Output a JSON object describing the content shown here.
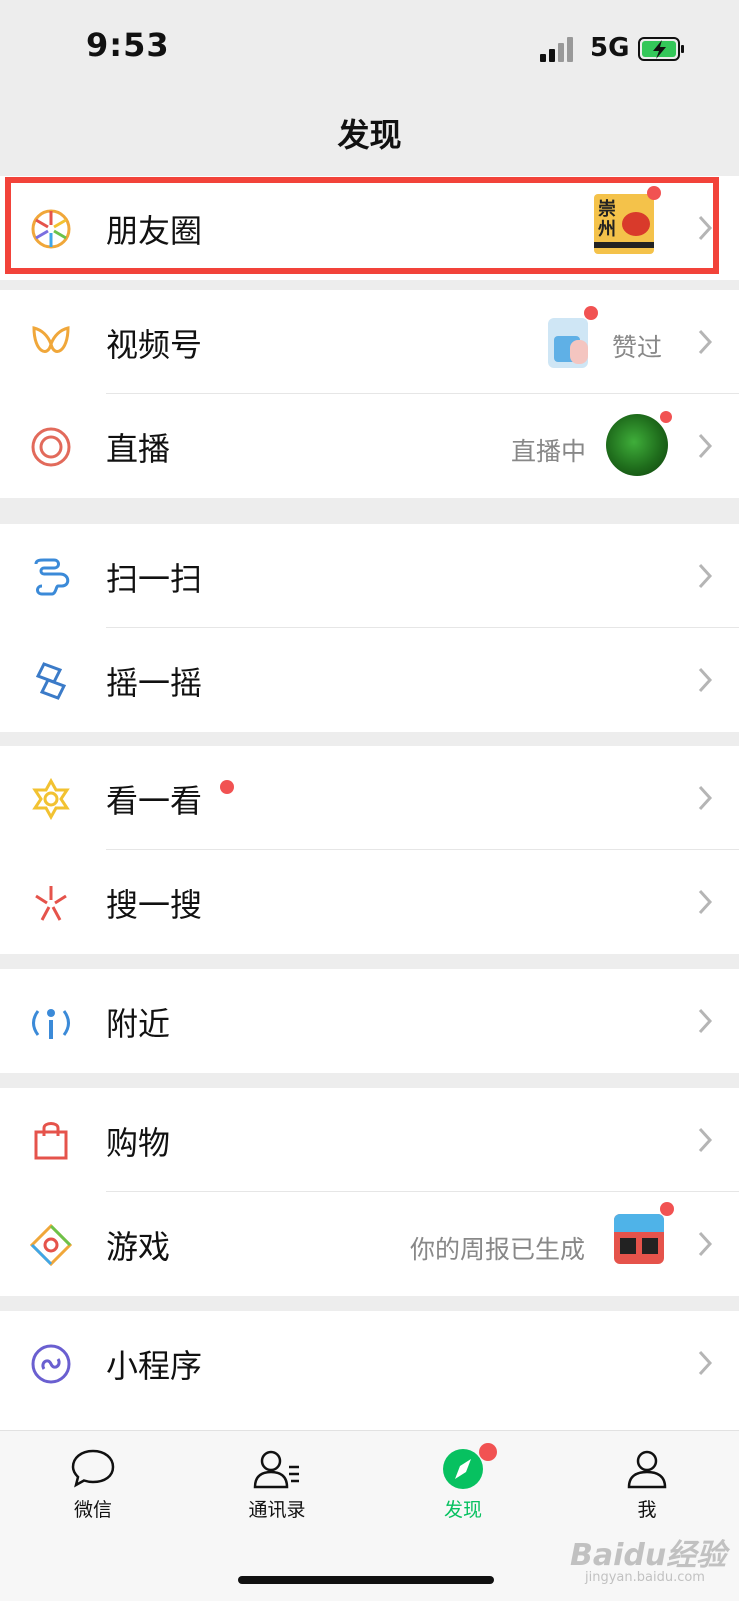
{
  "status_bar": {
    "time": "9:53",
    "network": "5G"
  },
  "nav": {
    "title": "发现"
  },
  "rows": {
    "moments": {
      "label": "朋友圈"
    },
    "channels": {
      "label": "视频号",
      "sub": "赞过"
    },
    "live": {
      "label": "直播",
      "sub": "直播中"
    },
    "scan": {
      "label": "扫一扫"
    },
    "shake": {
      "label": "摇一摇"
    },
    "top_stories": {
      "label": "看一看"
    },
    "search": {
      "label": "搜一搜"
    },
    "nearby": {
      "label": "附近"
    },
    "shopping": {
      "label": "购物"
    },
    "games": {
      "label": "游戏",
      "sub": "你的周报已生成"
    },
    "mini_programs": {
      "label": "小程序"
    }
  },
  "tabbar": {
    "chats": "微信",
    "contacts": "通讯录",
    "discover": "发现",
    "me": "我"
  },
  "colors": {
    "accent": "#07c160",
    "badge": "#f15252",
    "highlight": "#f2433a"
  },
  "watermark": {
    "brand": "Baidu经验",
    "domain": "jingyan.baidu.com"
  },
  "moments_thumb_text": "崇州"
}
